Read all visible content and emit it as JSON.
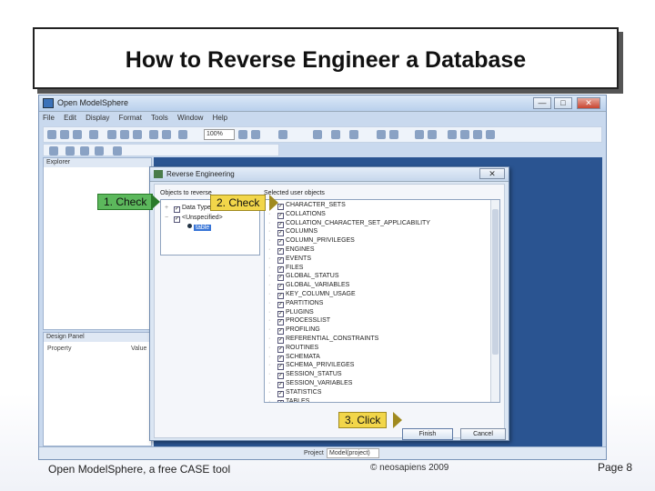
{
  "slide": {
    "title": "How to Reverse Engineer a Database",
    "footer_left": "Open ModelSphere, a free CASE tool",
    "footer_center": "© neosapiens 2009",
    "footer_page": "Page 8"
  },
  "app": {
    "window_title": "Open ModelSphere",
    "window_buttons": [
      "—",
      "□",
      "✕"
    ],
    "menu": [
      "File",
      "Edit",
      "Display",
      "Format",
      "Tools",
      "Window",
      "Help"
    ],
    "zoom": "100%",
    "explorer_label": "Explorer",
    "design_panel_label": "Design Panel",
    "design_columns": [
      "Property",
      "Value"
    ],
    "status_project_label": "Project",
    "status_project_value": "Model(project)"
  },
  "dialog": {
    "title": "Reverse Engineering",
    "close": "✕",
    "left_label": "Objects to reverse",
    "right_label": "Selected user objects",
    "left_tree": [
      {
        "label": "Data Types",
        "expander": "+",
        "checked": true,
        "selected": false
      },
      {
        "label": "<Unspecified>",
        "expander": "−",
        "checked": true,
        "selected": false
      },
      {
        "label": "table",
        "expander": "",
        "checked": false,
        "selected": true
      }
    ],
    "right_items": [
      "CHARACTER_SETS",
      "COLLATIONS",
      "COLLATION_CHARACTER_SET_APPLICABILITY",
      "COLUMNS",
      "COLUMN_PRIVILEGES",
      "ENGINES",
      "EVENTS",
      "FILES",
      "GLOBAL_STATUS",
      "GLOBAL_VARIABLES",
      "KEY_COLUMN_USAGE",
      "PARTITIONS",
      "PLUGINS",
      "PROCESSLIST",
      "PROFILING",
      "REFERENTIAL_CONSTRAINTS",
      "ROUTINES",
      "SCHEMATA",
      "SCHEMA_PRIVILEGES",
      "SESSION_STATUS",
      "SESSION_VARIABLES",
      "STATISTICS",
      "TABLES"
    ],
    "finish_label": "Finish",
    "cancel_label": "Cancel"
  },
  "callouts": {
    "step1": "1. Check",
    "step2": "2. Check",
    "step3": "3. Click"
  },
  "colors": {
    "canvas_blue": "#2a5491",
    "callout_green": "#5cb85c",
    "callout_yellow": "#f2d64a"
  }
}
